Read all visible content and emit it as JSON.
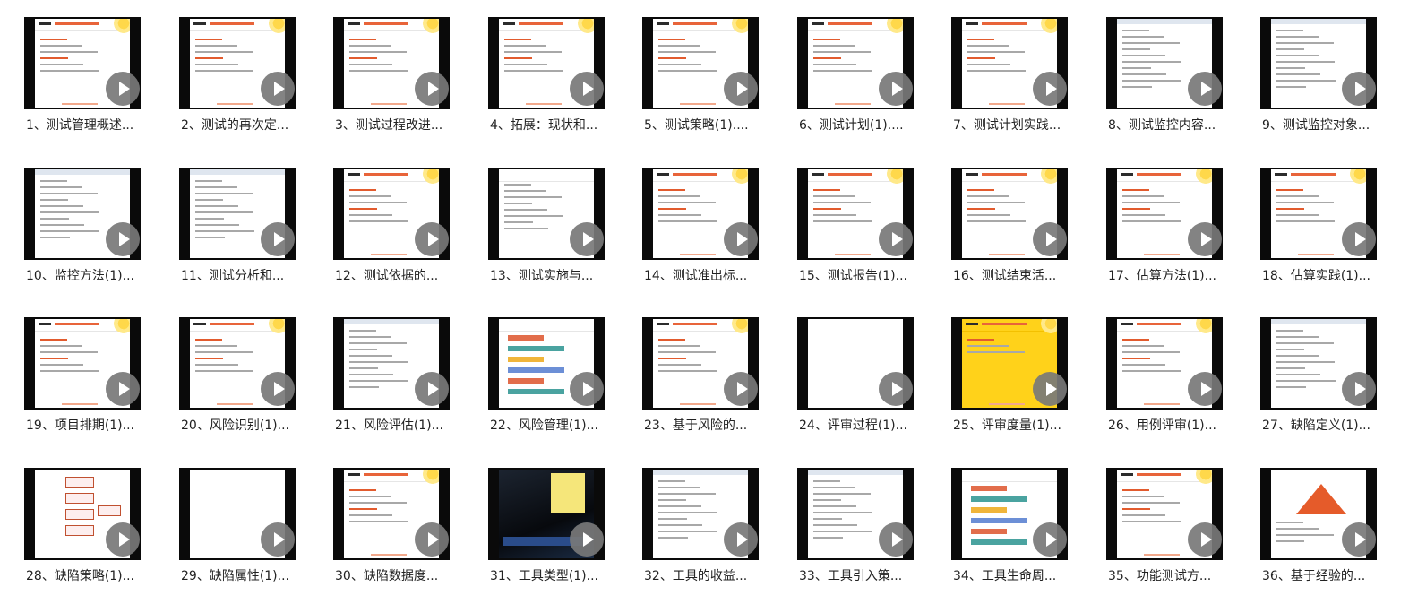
{
  "grid": {
    "items": [
      {
        "title": "1、测试管理概述...",
        "thumb_style": "dialog"
      },
      {
        "title": "2、测试的再次定...",
        "thumb_style": "slide"
      },
      {
        "title": "3、测试过程改进...",
        "thumb_style": "slide"
      },
      {
        "title": "4、拓展：现状和...",
        "thumb_style": "slide"
      },
      {
        "title": "5、测试策略(1)....",
        "thumb_style": "slide"
      },
      {
        "title": "6、测试计划(1)....",
        "thumb_style": "slide"
      },
      {
        "title": "7、测试计划实践...",
        "thumb_style": "slide"
      },
      {
        "title": "8、测试监控内容...",
        "thumb_style": "doc"
      },
      {
        "title": "9、测试监控对象...",
        "thumb_style": "doc"
      },
      {
        "title": "10、监控方法(1)...",
        "thumb_style": "doc"
      },
      {
        "title": "11、测试分析和...",
        "thumb_style": "doc"
      },
      {
        "title": "12、测试依据的...",
        "thumb_style": "slide"
      },
      {
        "title": "13、测试实施与...",
        "thumb_style": "web"
      },
      {
        "title": "14、测试准出标...",
        "thumb_style": "slide"
      },
      {
        "title": "15、测试报告(1)...",
        "thumb_style": "slide"
      },
      {
        "title": "16、测试结束活...",
        "thumb_style": "slide"
      },
      {
        "title": "17、估算方法(1)...",
        "thumb_style": "slide"
      },
      {
        "title": "18、估算实践(1)...",
        "thumb_style": "slide"
      },
      {
        "title": "19、项目排期(1)...",
        "thumb_style": "slide"
      },
      {
        "title": "20、风险识别(1)...",
        "thumb_style": "slide"
      },
      {
        "title": "21、风险评估(1)...",
        "thumb_style": "doc"
      },
      {
        "title": "22、风险管理(1)...",
        "thumb_style": "bars"
      },
      {
        "title": "23、基于风险的...",
        "thumb_style": "slide"
      },
      {
        "title": "24、评审过程(1)...",
        "thumb_style": "blank"
      },
      {
        "title": "25、评审度量(1)...",
        "thumb_style": "yellow"
      },
      {
        "title": "26、用例评审(1)...",
        "thumb_style": "slide"
      },
      {
        "title": "27、缺陷定义(1)...",
        "thumb_style": "doc"
      },
      {
        "title": "28、缺陷策略(1)...",
        "thumb_style": "flow"
      },
      {
        "title": "29、缺陷属性(1)...",
        "thumb_style": "blank"
      },
      {
        "title": "30、缺陷数据度...",
        "thumb_style": "slide"
      },
      {
        "title": "31、工具类型(1)...",
        "thumb_style": "photo"
      },
      {
        "title": "32、工具的收益...",
        "thumb_style": "doc"
      },
      {
        "title": "33、工具引入策...",
        "thumb_style": "doc"
      },
      {
        "title": "34、工具生命周...",
        "thumb_style": "bars"
      },
      {
        "title": "35、功能测试方...",
        "thumb_style": "slide"
      },
      {
        "title": "36、基于经验的...",
        "thumb_style": "pyr"
      }
    ]
  },
  "colors": {
    "play_button": "#787878",
    "slide_accent": "#e8643a",
    "honeycomb": "#ffd84a"
  },
  "icons": {
    "play": "play-icon"
  }
}
